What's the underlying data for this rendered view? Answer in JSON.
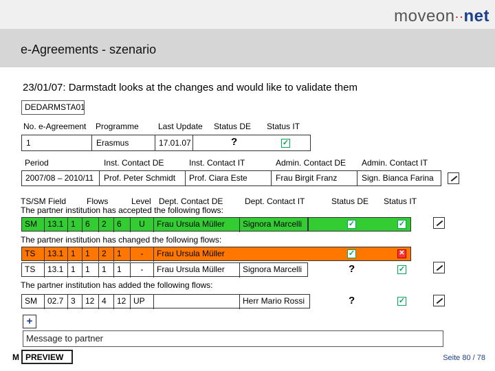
{
  "brand": {
    "logo_left": "moveon",
    "logo_dots": "··",
    "logo_right": "net"
  },
  "header": {
    "title": "e-Agreements - szenario"
  },
  "scenario": {
    "text": "23/01/07: Darmstadt looks at the changes and would like to validate them"
  },
  "institution_code": "DEDARMSTA01",
  "agreement": {
    "headers": [
      "No. e-Agreement",
      "Programme",
      "Last Update",
      "Status DE",
      "Status IT"
    ],
    "values": {
      "no": "1",
      "programme": "Erasmus",
      "last_update": "17.01.07",
      "status_de": "?"
    }
  },
  "contacts": {
    "headers": [
      "Period",
      "Inst. Contact DE",
      "Inst. Contact IT",
      "Admin. Contact DE",
      "Admin. Contact IT"
    ],
    "values": [
      "2007/08 – 2010/11",
      "Prof. Peter Schmidt",
      "Prof. Ciara Este",
      "Frau Birgit Franz",
      "Sign. Bianca Farina"
    ]
  },
  "flows": {
    "headers": {
      "ts_sm_field": "TS/SM Field",
      "flows": "Flows",
      "level": "Level",
      "dept_de": "Dept. Contact DE",
      "dept_it": "Dept. Contact IT",
      "status_de": "Status DE",
      "status_it": "Status IT"
    },
    "accepted_label": "The partner institution has accepted the following flows:",
    "changed_label": "The partner institution has changed the following flows:",
    "added_label": "The partner institution has added the following flows:",
    "accepted": [
      {
        "type": "SM",
        "field": "13.1",
        "a": "1",
        "b": "6",
        "c": "2",
        "d": "6",
        "level": "U",
        "dept_de": "Frau Ursula Müller",
        "dept_it": "Signora Marcelli"
      }
    ],
    "changed": [
      {
        "type": "TS",
        "field": "13.1",
        "a": "1",
        "b": "1",
        "c": "2",
        "d": "1",
        "level": "-",
        "dept_de": "Frau Ursula Müller",
        "dept_it": ""
      },
      {
        "type": "TS",
        "field": "13.1",
        "a": "1",
        "b": "1",
        "c": "1",
        "d": "1",
        "level": "-",
        "dept_de": "Frau Ursula Müller",
        "dept_it": "Signora Marcelli",
        "status_de": "?"
      }
    ],
    "added": [
      {
        "type": "SM",
        "field": "02.7",
        "a": "3",
        "b": "12",
        "c": "4",
        "d": "12",
        "level": "UP",
        "dept_de": "",
        "dept_it": "Herr Mario Rossi",
        "status_de": "?"
      }
    ]
  },
  "add_button": "+",
  "message": {
    "placeholder": "Message to partner"
  },
  "preview": {
    "prefix": "M",
    "label": "PREVIEW"
  },
  "footer": {
    "page": "Seite 80 / 78"
  },
  "colors": {
    "accepted": "#33cc33",
    "changed": "#ff7700",
    "brand": "#1b3f88"
  }
}
